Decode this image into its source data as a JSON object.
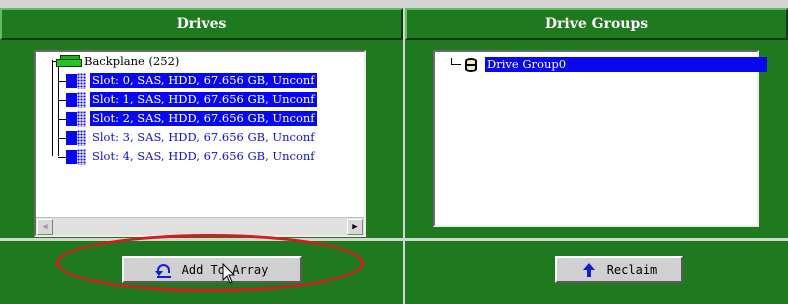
{
  "drives_panel": {
    "title": "Drives",
    "backplane": {
      "label": "Backplane (252)"
    },
    "slots": [
      {
        "label": "Slot: 0, SAS, HDD, 67.656 GB, Unconf",
        "selected": true
      },
      {
        "label": "Slot: 1, SAS, HDD, 67.656 GB, Unconf",
        "selected": true
      },
      {
        "label": "Slot: 2, SAS, HDD, 67.656 GB, Unconf",
        "selected": true
      },
      {
        "label": "Slot: 3, SAS, HDD, 67.656 GB, Unconf",
        "selected": false
      },
      {
        "label": "Slot: 4, SAS, HDD, 67.656 GB, Unconf",
        "selected": false
      }
    ],
    "button_label": "Add To Array",
    "button_icon": "undo-icon"
  },
  "drive_groups_panel": {
    "title": "Drive Groups",
    "groups": [
      {
        "label": "Drive Group0",
        "selected": true
      }
    ],
    "button_label": "Reclaim",
    "button_icon": "arrow-up-icon"
  },
  "colors": {
    "panel_green": "#1f7a1f",
    "selection_blue": "#0808f0",
    "annotation_red": "#d41c1c"
  }
}
